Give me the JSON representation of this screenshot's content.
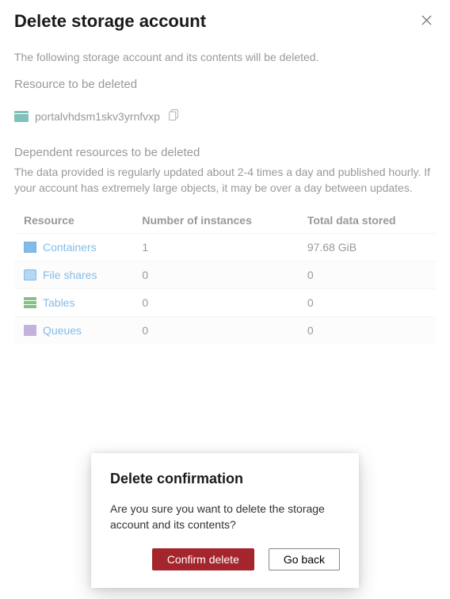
{
  "header": {
    "title": "Delete storage account"
  },
  "intro": "The following storage account and its contents will be deleted.",
  "resource_section": {
    "label": "Resource to be deleted",
    "resource_name": "portalvhdsm1skv3yrnfvxp"
  },
  "dependent_section": {
    "label": "Dependent resources to be deleted",
    "description": "The data provided is regularly updated about 2-4 times a day and published hourly. If your account has extremely large objects, it may be over a day between updates."
  },
  "table": {
    "columns": {
      "col1": "Resource",
      "col2": "Number of instances",
      "col3": "Total data stored"
    },
    "rows": [
      {
        "name": "Containers",
        "icon": "container-icon",
        "instances": "1",
        "stored": "97.68 GiB"
      },
      {
        "name": "File shares",
        "icon": "fileshare-icon",
        "instances": "0",
        "stored": "0"
      },
      {
        "name": "Tables",
        "icon": "table-icon",
        "instances": "0",
        "stored": "0"
      },
      {
        "name": "Queues",
        "icon": "queue-icon",
        "instances": "0",
        "stored": "0"
      }
    ]
  },
  "modal": {
    "title": "Delete confirmation",
    "body": "Are you sure you want to delete the storage account and its contents?",
    "confirm_label": "Confirm delete",
    "cancel_label": "Go back"
  }
}
